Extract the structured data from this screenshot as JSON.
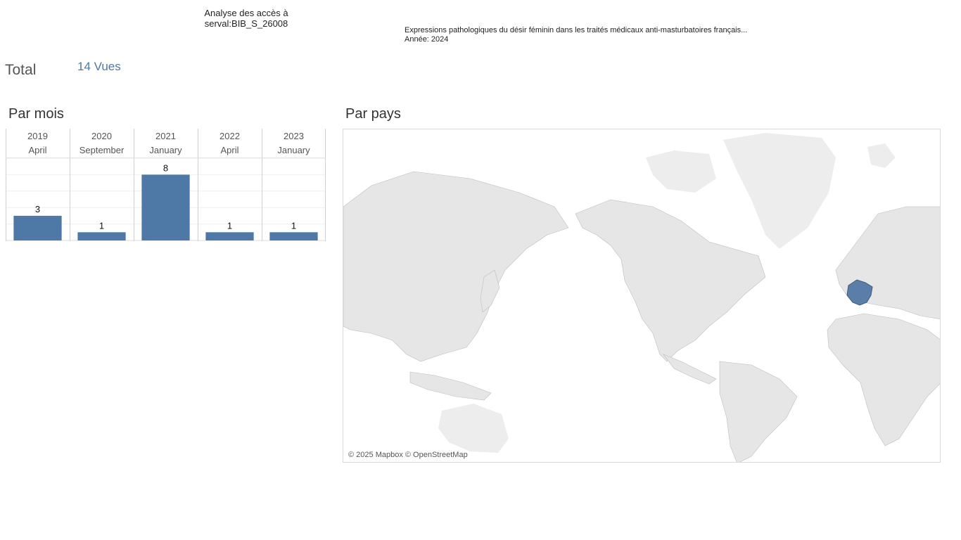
{
  "header": {
    "title_line1": "Analyse des accès à",
    "title_line2": "serval:BIB_S_26008",
    "pub_title": "Expressions pathologiques du désir féminin dans les traités médicaux anti-masturbatoires français...",
    "pub_year": "Année: 2024"
  },
  "total": {
    "label": "Total",
    "value": "14 Vues"
  },
  "sections": {
    "by_month": "Par mois",
    "by_country": "Par pays"
  },
  "chart_data": {
    "type": "bar",
    "categories": [
      {
        "year": "2019",
        "month": "April"
      },
      {
        "year": "2020",
        "month": "September"
      },
      {
        "year": "2021",
        "month": "January"
      },
      {
        "year": "2022",
        "month": "April"
      },
      {
        "year": "2023",
        "month": "January"
      }
    ],
    "values": [
      3,
      1,
      8,
      1,
      1
    ],
    "ylim": [
      0,
      10
    ],
    "grid": true,
    "bar_color": "#4e79a7"
  },
  "map": {
    "highlighted_countries": [
      "France"
    ],
    "highlight_color": "#5b7ea8",
    "attribution": "© 2025 Mapbox © OpenStreetMap"
  }
}
